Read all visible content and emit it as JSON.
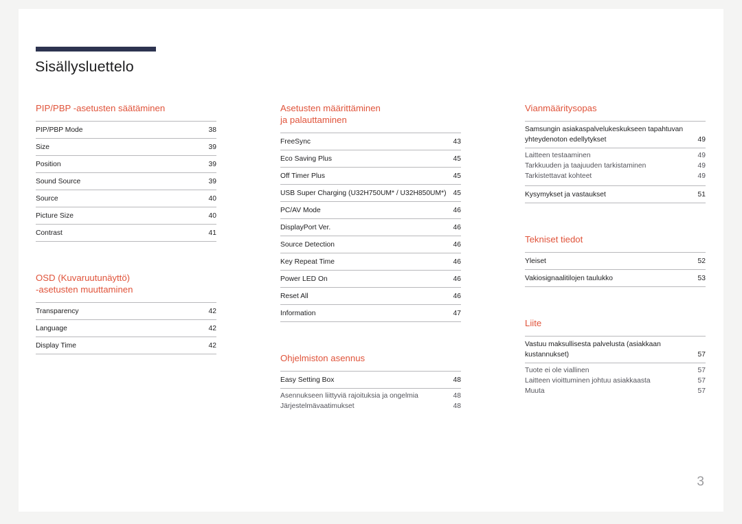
{
  "document": {
    "title": "Sisällysluettelo",
    "page_number": "3",
    "accent_color": "#e0533a",
    "rule_color": "#2d3350"
  },
  "columns": [
    {
      "sections": [
        {
          "title": "PIP/PBP -asetusten säätäminen",
          "entries": [
            {
              "label": "PIP/PBP Mode",
              "page": "38",
              "sub": false
            },
            {
              "label": "Size",
              "page": "39",
              "sub": false
            },
            {
              "label": "Position",
              "page": "39",
              "sub": false
            },
            {
              "label": "Sound Source",
              "page": "39",
              "sub": false
            },
            {
              "label": "Source",
              "page": "40",
              "sub": false
            },
            {
              "label": "Picture Size",
              "page": "40",
              "sub": false
            },
            {
              "label": "Contrast",
              "page": "41",
              "sub": false
            }
          ]
        },
        {
          "title": "OSD (Kuvaruutunäyttö)\n-asetusten muuttaminen",
          "entries": [
            {
              "label": "Transparency",
              "page": "42",
              "sub": false
            },
            {
              "label": "Language",
              "page": "42",
              "sub": false
            },
            {
              "label": "Display Time",
              "page": "42",
              "sub": false
            }
          ]
        }
      ]
    },
    {
      "sections": [
        {
          "title": "Asetusten määrittäminen\nja palauttaminen",
          "entries": [
            {
              "label": "FreeSync",
              "page": "43",
              "sub": false
            },
            {
              "label": "Eco Saving Plus",
              "page": "45",
              "sub": false
            },
            {
              "label": "Off Timer Plus",
              "page": "45",
              "sub": false
            },
            {
              "label": "USB Super Charging (U32H750UM* / U32H850UM*)",
              "page": "45",
              "sub": false
            },
            {
              "label": "PC/AV Mode",
              "page": "46",
              "sub": false
            },
            {
              "label": "DisplayPort Ver.",
              "page": "46",
              "sub": false
            },
            {
              "label": "Source Detection",
              "page": "46",
              "sub": false
            },
            {
              "label": "Key Repeat Time",
              "page": "46",
              "sub": false
            },
            {
              "label": "Power LED On",
              "page": "46",
              "sub": false
            },
            {
              "label": "Reset All",
              "page": "46",
              "sub": false
            },
            {
              "label": "Information",
              "page": "47",
              "sub": false
            }
          ]
        },
        {
          "title": "Ohjelmiston asennus",
          "entries": [
            {
              "label": "Easy Setting Box",
              "page": "48",
              "sub": false
            },
            {
              "label": "Asennukseen liittyviä rajoituksia ja ongelmia",
              "page": "48",
              "sub": true
            },
            {
              "label": "Järjestelmävaatimukset",
              "page": "48",
              "sub": true
            }
          ]
        }
      ]
    },
    {
      "sections": [
        {
          "title": "Vianmääritysopas",
          "entries": [
            {
              "label": "Samsungin asiakaspalvelukeskukseen tapahtuvan yhteydenoton edellytykset",
              "page": "49",
              "sub": false
            },
            {
              "label": "Laitteen testaaminen",
              "page": "49",
              "sub": true
            },
            {
              "label": "Tarkkuuden ja taajuuden tarkistaminen",
              "page": "49",
              "sub": true
            },
            {
              "label": "Tarkistettavat kohteet",
              "page": "49",
              "sub": true
            },
            {
              "label": "Kysymykset ja vastaukset",
              "page": "51",
              "sub": false,
              "ruled_top": true
            }
          ]
        },
        {
          "title": "Tekniset tiedot",
          "entries": [
            {
              "label": "Yleiset",
              "page": "52",
              "sub": false
            },
            {
              "label": "Vakiosignaalitilojen taulukko",
              "page": "53",
              "sub": false
            }
          ]
        },
        {
          "title": "Liite",
          "entries": [
            {
              "label": "Vastuu maksullisesta palvelusta (asiakkaan kustannukset)",
              "page": "57",
              "sub": false
            },
            {
              "label": "Tuote ei ole viallinen",
              "page": "57",
              "sub": true
            },
            {
              "label": "Laitteen vioittuminen johtuu asiakkaasta",
              "page": "57",
              "sub": true
            },
            {
              "label": "Muuta",
              "page": "57",
              "sub": true
            }
          ]
        }
      ]
    }
  ]
}
